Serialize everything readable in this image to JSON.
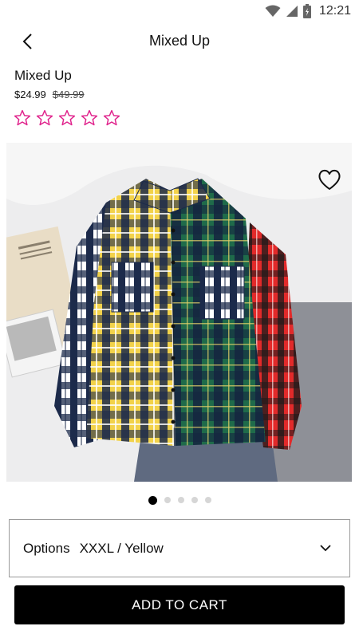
{
  "status_bar": {
    "time": "12:21",
    "icons": [
      "wifi-icon",
      "signal-icon",
      "battery-icon"
    ]
  },
  "app_bar": {
    "back_icon": "back-arrow-icon",
    "title": "Mixed Up"
  },
  "product": {
    "name": "Mixed Up",
    "price": "$24.99",
    "original_price": "$49.99",
    "rating": {
      "value": 0,
      "max": 5,
      "star_color": "#e0238c"
    },
    "image_description_icon": "plaid-shirt-photo",
    "wishlist_icon": "heart-outline-icon"
  },
  "carousel": {
    "total": 5,
    "active_index": 0
  },
  "options": {
    "label": "Options",
    "selected_value": "XXXL / Yellow",
    "icon": "chevron-down-icon"
  },
  "cart": {
    "button_label": "ADD TO CART"
  },
  "colors": {
    "accent": "#e0238c",
    "button_bg": "#000000",
    "button_text": "#ffffff"
  }
}
